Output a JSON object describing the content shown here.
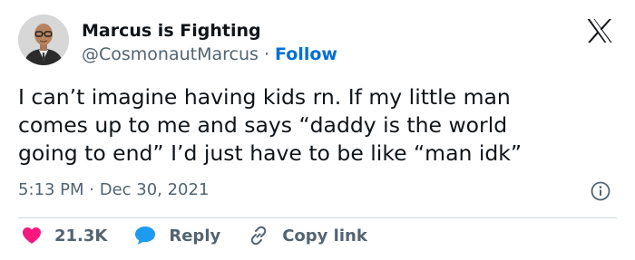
{
  "author": {
    "display_name": "Marcus is Fighting",
    "handle": "@CosmonautMarcus",
    "separator": " · ",
    "follow_label": "Follow"
  },
  "tweet": {
    "lines": [
      "I can’t imagine having kids rn. If my little man",
      "comes up to me and says “daddy is the world",
      "going to end” I’d just have to be like “man idk”"
    ],
    "time": "5:13 PM",
    "separator": " · ",
    "date": "Dec 30, 2021"
  },
  "actions": {
    "like_count": "21.3K",
    "reply_label": "Reply",
    "copy_link_label": "Copy link"
  },
  "icons": {
    "logo": "x-logo-icon",
    "info": "info-icon",
    "like": "heart-icon",
    "reply": "speech-bubble-icon",
    "copy": "link-icon"
  },
  "colors": {
    "text": "#0f1419",
    "secondary": "#536471",
    "follow": "#006fd6",
    "like": "#f91880",
    "reply": "#1d9bf0",
    "divider": "#cfd9de"
  }
}
